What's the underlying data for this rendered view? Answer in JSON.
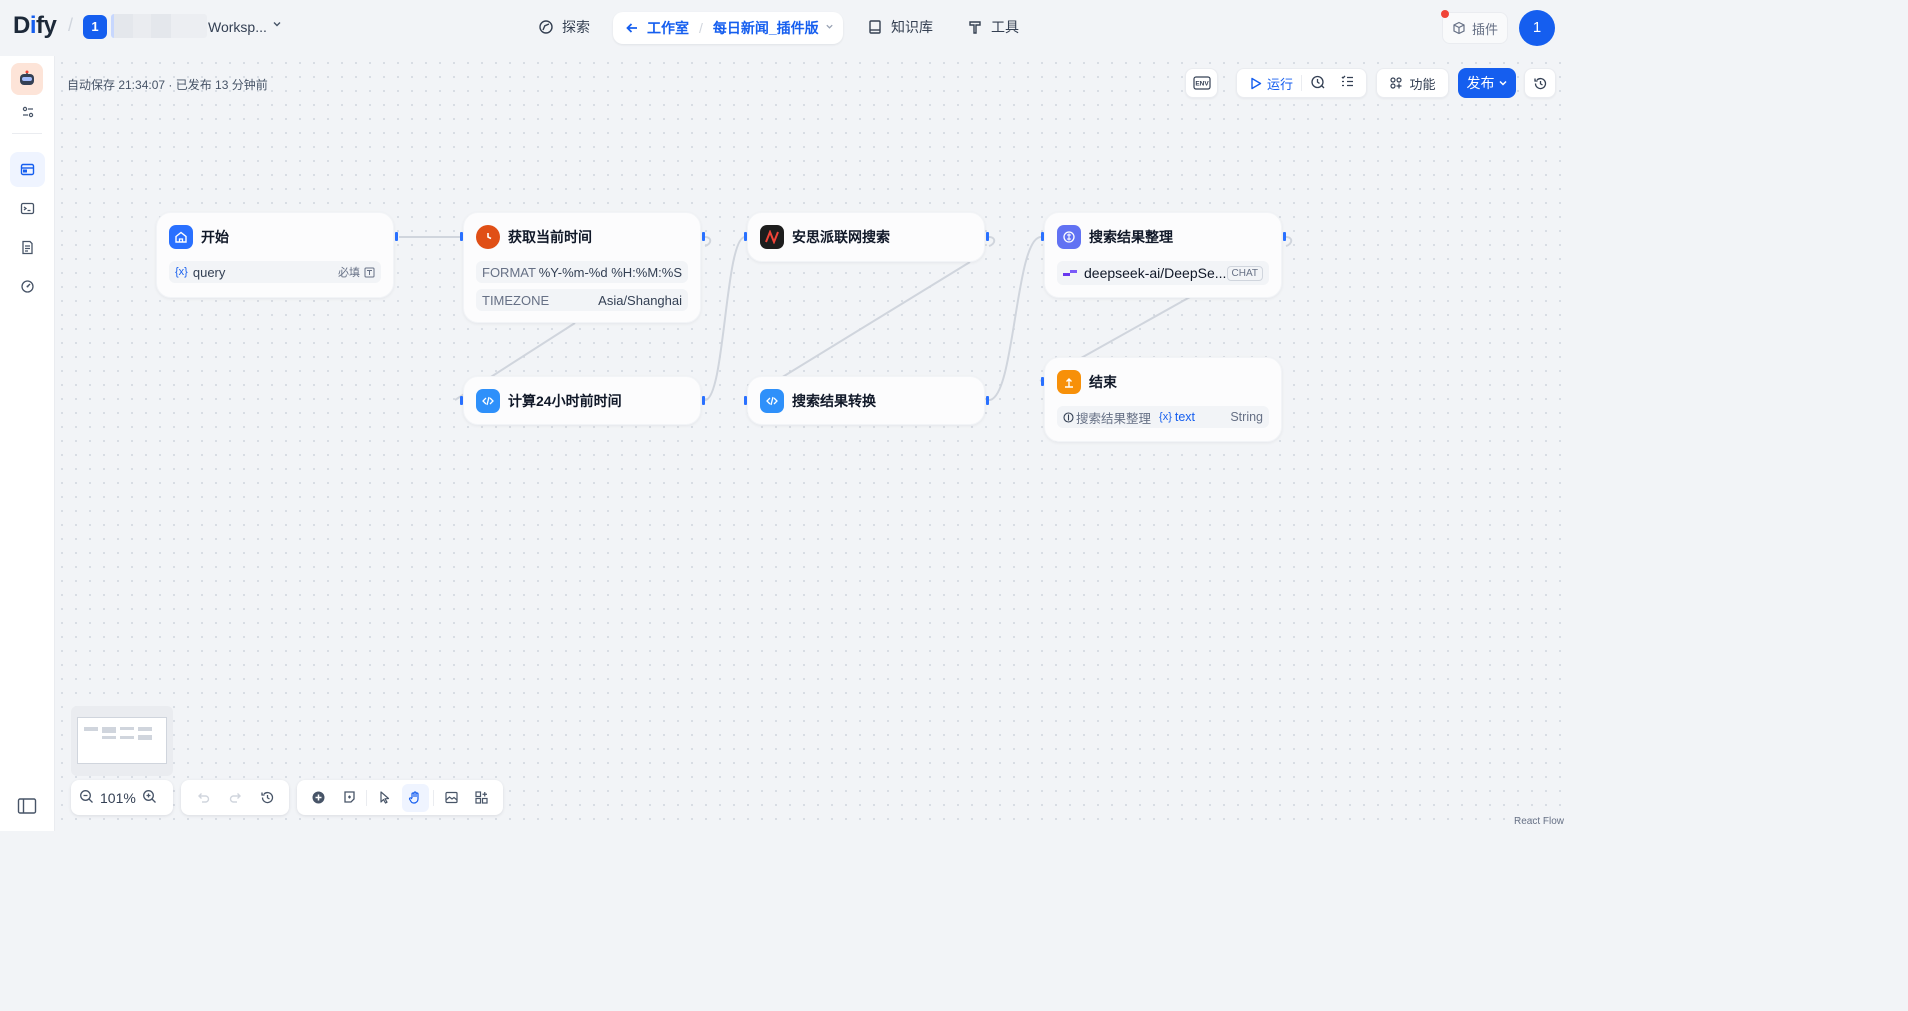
{
  "header": {
    "logo": {
      "pre": "D",
      "i": "i",
      "post": "fy"
    },
    "workspace_badge": "1",
    "workspace_name": "Worksp...",
    "nav": {
      "explore": "探索",
      "studio": "工作室",
      "app_name": "每日新闻_插件版",
      "knowledge": "知识库",
      "tools": "工具"
    },
    "plugin": "插件",
    "avatar": "1"
  },
  "status": {
    "autosave": "自动保存 21:34:07 · 已发布 13 分钟前"
  },
  "toolbar": {
    "env": "ENV",
    "run": "运行",
    "features": "功能",
    "publish": "发布"
  },
  "nodes": {
    "start": {
      "title": "开始",
      "var": "query",
      "required": "必填"
    },
    "get_time": {
      "title": "获取当前时间",
      "rows": [
        {
          "key": "FORMAT",
          "value": "%Y-%m-%d %H:%M:%S"
        },
        {
          "key": "TIMEZONE",
          "value": "Asia/Shanghai"
        }
      ]
    },
    "calc_24h": {
      "title": "计算24小时前时间"
    },
    "search": {
      "title": "安思派联网搜索"
    },
    "transform": {
      "title": "搜索结果转换"
    },
    "organize": {
      "title": "搜索结果整理",
      "model": "deepseek-ai/DeepSe...",
      "model_tag": "CHAT"
    },
    "end": {
      "title": "结束",
      "source": "搜索结果整理",
      "var": "text",
      "type": "String"
    }
  },
  "controls": {
    "zoom": "101%"
  },
  "attribution": "React Flow",
  "colors": {
    "accent": "#155eef",
    "start": "#2970ff",
    "time": "#e04f16",
    "code": "#2e90fa",
    "llm": "#6172f3",
    "end": "#f79009"
  }
}
